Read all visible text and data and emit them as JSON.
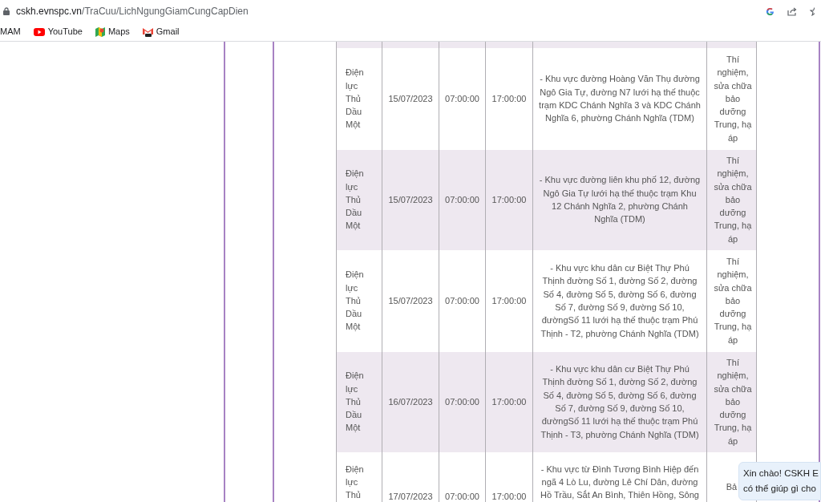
{
  "address_bar": {
    "host": "cskh.evnspc.vn",
    "path": "/TraCuu/LichNgungGiamCungCapDien"
  },
  "bookmarks": [
    {
      "label": "MAM",
      "kind": "plain"
    },
    {
      "label": "YouTube",
      "kind": "youtube"
    },
    {
      "label": "Maps",
      "kind": "maps"
    },
    {
      "label": "Gmail",
      "kind": "gmail"
    }
  ],
  "table": {
    "rows": [
      {
        "unit": "Điện lực Thủ Dầu Một",
        "date": "15/07/2023",
        "start": "07:00:00",
        "end": "17:00:00",
        "area": "- Khu vực đường Hoàng Văn Thụ đường Ngô Gia Tự, đường N7 lưới hạ thế thuộc trạm KDC Chánh Nghĩa 3 và KDC Chánh Nghĩa 6, phường Chánh Nghĩa (TDM)",
        "reason": "Thí nghiệm, sửa chữa bảo dưỡng Trung, hạ áp"
      },
      {
        "unit": "Điện lực Thủ Dầu Một",
        "date": "15/07/2023",
        "start": "07:00:00",
        "end": "17:00:00",
        "area": "- Khu vực đường liên khu phố 12, đường Ngô Gia Tự lưới hạ thế thuộc trạm Khu 12 Chánh Nghĩa 2, phường Chánh Nghĩa (TDM)",
        "reason": "Thí nghiệm, sửa chữa bảo dưỡng Trung, hạ áp"
      },
      {
        "unit": "Điện lực Thủ Dầu Một",
        "date": "15/07/2023",
        "start": "07:00:00",
        "end": "17:00:00",
        "area": "- Khu vực khu dân cư Biệt Thự Phú Thịnh đường Số 1, đường Số 2, đường Số 4, đường Số 5, đường Số 6, đường Số 7, đường Số 9, đường Số 10, đườngSố 11 lưới hạ thế thuộc trạm Phú Thịnh - T2, phường Chánh Nghĩa (TDM)",
        "reason": "Thí nghiệm, sửa chữa bảo dưỡng Trung, hạ áp"
      },
      {
        "unit": "Điện lực Thủ Dầu Một",
        "date": "16/07/2023",
        "start": "07:00:00",
        "end": "17:00:00",
        "area": "- Khu vực khu dân cư Biệt Thự Phú Thịnh đường Số 1, đường Số 2, đường Số 4, đường Số 5, đường Số 6, đường Số 7, đường Số 9, đường Số 10, đườngSố 11 lưới hạ thế thuộc trạm Phú Thịnh - T3, phường Chánh Nghĩa (TDM)",
        "reason": "Thí nghiệm, sửa chữa bảo dưỡng Trung, hạ áp"
      },
      {
        "unit": "Điện lực Thủ",
        "date": "17/07/2023",
        "start": "07:00:00",
        "end": "17:00:00",
        "area": "- Khu vực từ Đình Tương Bình Hiệp đến ngã 4 Lò Lu, đường Lê Chí Dân, đường Hồ Trầu, Sắt An Bình, Thiên Hồng, Sông",
        "reason": "Bả"
      }
    ]
  },
  "chat_bubble": {
    "lines": [
      "Xin chào! CSKH E",
      "có thể giúp gì cho"
    ]
  }
}
